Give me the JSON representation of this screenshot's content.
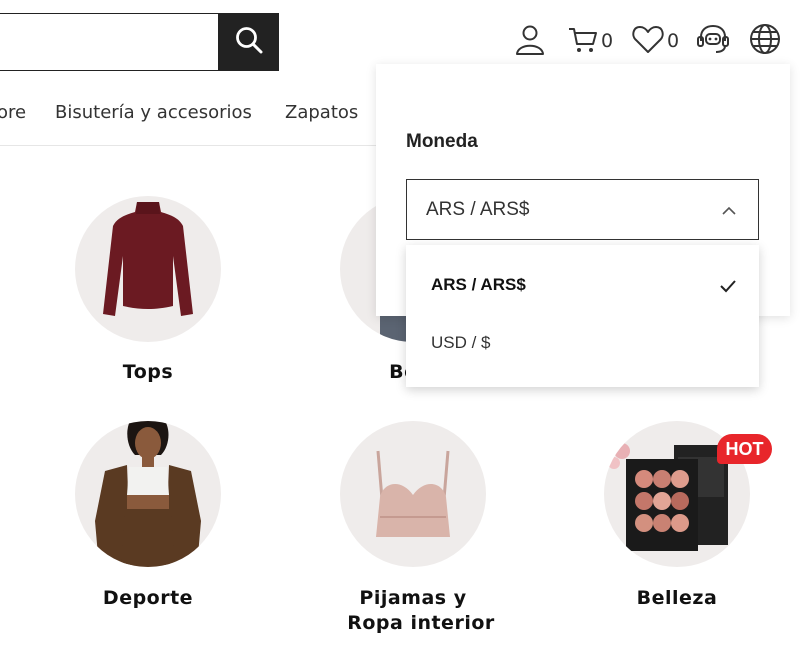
{
  "header": {
    "search": {
      "value": "",
      "placeholder": ""
    },
    "cart_count": "0",
    "wishlist_count": "0"
  },
  "nav": {
    "items": [
      {
        "label": "ore"
      },
      {
        "label": "Bisutería y accesorios"
      },
      {
        "label": "Zapatos"
      }
    ]
  },
  "categories": [
    {
      "label": "Tops"
    },
    {
      "label": "Bott"
    },
    {
      "label": "Deporte"
    },
    {
      "label": "Pijamas y"
    },
    {
      "label": "Ropa interior"
    },
    {
      "label": "Belleza",
      "badge": "HOT"
    }
  ],
  "currency": {
    "title": "Moneda",
    "selected": "ARS / ARS$",
    "options": [
      {
        "label": "ARS / ARS$",
        "selected": true
      },
      {
        "label": "USD / $",
        "selected": false
      }
    ]
  },
  "colors": {
    "accent": "#222222",
    "hot_badge": "#e8262b",
    "circle_bg": "#efeceb"
  },
  "icons": [
    "search-icon",
    "user-icon",
    "cart-icon",
    "heart-icon",
    "support-icon",
    "globe-icon",
    "chevron-up-icon",
    "check-icon"
  ]
}
